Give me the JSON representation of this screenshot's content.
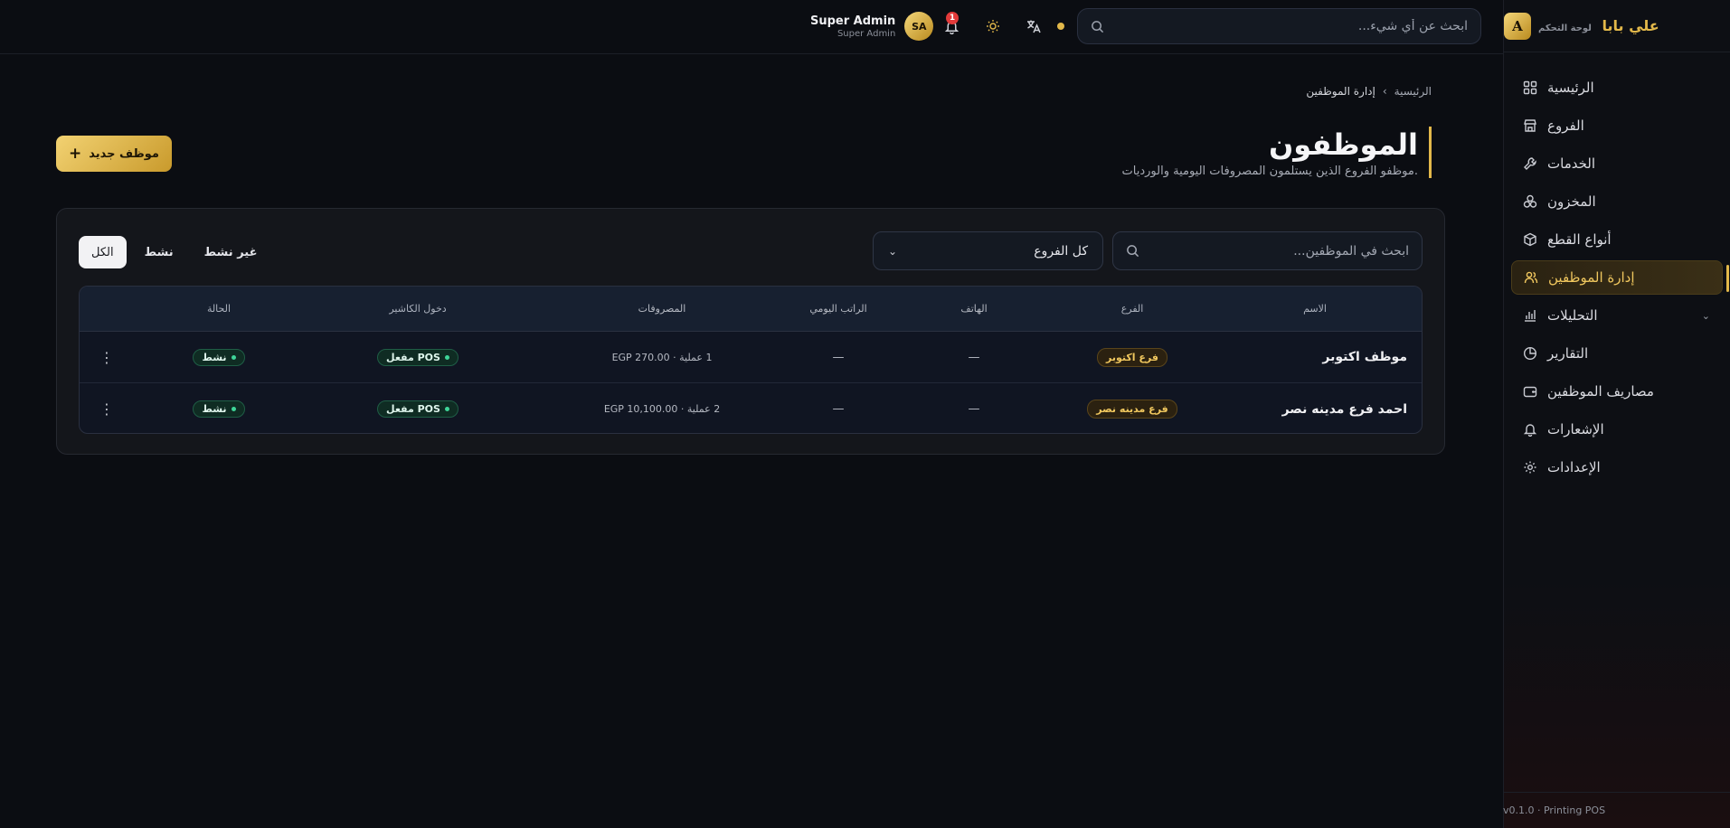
{
  "brand": {
    "logo_letter": "A",
    "name": "علي بابا",
    "subtitle": "لوحة التحكم"
  },
  "sidebar": {
    "items": [
      {
        "label": "الرئيسية",
        "icon": "dashboard-icon"
      },
      {
        "label": "الفروع",
        "icon": "store-icon"
      },
      {
        "label": "الخدمات",
        "icon": "wrench-icon"
      },
      {
        "label": "المخزون",
        "icon": "boxes-icon"
      },
      {
        "label": "أنواع القطع",
        "icon": "cube-icon"
      },
      {
        "label": "إدارة الموظفين",
        "icon": "users-icon",
        "active": true
      },
      {
        "label": "التحليلات",
        "icon": "bar-chart-icon",
        "expandable": true
      },
      {
        "label": "التقارير",
        "icon": "pie-chart-icon"
      },
      {
        "label": "مصاريف الموظفين",
        "icon": "wallet-icon"
      },
      {
        "label": "الإشعارات",
        "icon": "bell-icon"
      },
      {
        "label": "الإعدادات",
        "icon": "gear-icon"
      }
    ],
    "footer": "v0.1.0 · Printing POS"
  },
  "topbar": {
    "search_placeholder": "ابحث عن أي شيء...",
    "notification_count": "1",
    "user_name": "Super Admin",
    "user_role": "Super Admin",
    "user_initials": "SA"
  },
  "breadcrumb": {
    "home": "الرئيسية",
    "separator": "›",
    "current": "إدارة الموظفين"
  },
  "page": {
    "title": "الموظفون",
    "subtitle": "موظفو الفروع الذين يستلمون المصروفات اليومية والورديات.",
    "new_button": "موظف جديد"
  },
  "filters": {
    "search_placeholder": "ابحث في الموظفين...",
    "branch_select": "كل الفروع",
    "tabs": [
      {
        "label": "الكل",
        "active": true
      },
      {
        "label": "نشط"
      },
      {
        "label": "غير نشط"
      }
    ]
  },
  "table": {
    "columns": [
      "الاسم",
      "الفرع",
      "الهاتف",
      "الراتب اليومي",
      "المصروفات",
      "دخول الكاشير",
      "الحالة"
    ],
    "rows": [
      {
        "name": "موظف اكتوبر",
        "branch": "فرع اكتوبر",
        "phone": "—",
        "daily_salary": "—",
        "expenses": "1 عملية · EGP 270.00",
        "cashier": "POS مفعل",
        "status": "نشط"
      },
      {
        "name": "احمد فرع مدينه نصر",
        "branch": "فرع مدينه نصر",
        "phone": "—",
        "daily_salary": "—",
        "expenses": "2 عملية · EGP 10,100.00",
        "cashier": "POS مفعل",
        "status": "نشط"
      }
    ]
  }
}
